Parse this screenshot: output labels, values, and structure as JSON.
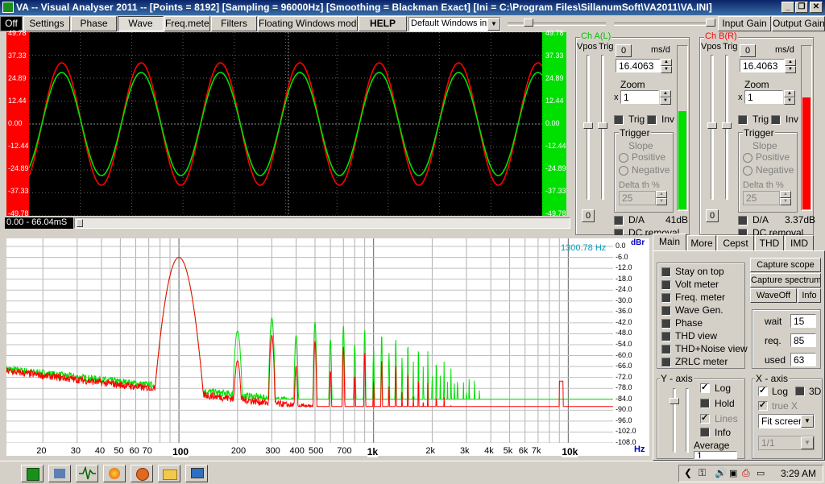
{
  "window": {
    "title": "VA -- Visual Analyser 2011 --  [Points = 8192]  [Sampling = 96000Hz]  [Smoothing = Blackman Exact]  [Ini = C:\\Program Files\\SillanumSoft\\VA2011\\VA.INI]"
  },
  "toolbar": {
    "off": "Off",
    "settings": "Settings",
    "phase": "Phase",
    "wave": "Wave",
    "freqmeter": "Freq.meter",
    "filters": "Filters",
    "floating": "Floating Windows mode",
    "help": "HELP",
    "layout_select": "Default Windows inp",
    "input_gain": "Input Gain",
    "output_gain": "Output Gain"
  },
  "scope": {
    "left_ticks": [
      "49.78",
      "37.33",
      "24.89",
      "12.44",
      "0.00",
      "-12.44",
      "-24.89",
      "-37.33",
      "-49.78"
    ],
    "right_ticks": [
      "49.78",
      "37.33",
      "24.89",
      "12.44",
      "0.00",
      "-12.44",
      "-24.89",
      "-37.33",
      "-49.78"
    ],
    "time_range": "0.00 - 66.04mS"
  },
  "channel_left": {
    "title": "Ch A(L)",
    "vpos": "Vpos",
    "trig": "Trig",
    "ms_value": "0",
    "ms_unit": "ms/d",
    "ms_field": "16.4063",
    "zoom_label": "Zoom",
    "zoom_x": "x",
    "zoom_value": "1",
    "trig_chk": "Trig",
    "inv_chk": "Inv",
    "trigger_group": "Trigger",
    "slope": "Slope",
    "positive": "Positive",
    "negative": "Negative",
    "delta": "Delta th %",
    "delta_value": "25",
    "vpos_value": "0",
    "da": "D/A",
    "dcremoval": "DC removal",
    "level": "41dB",
    "level_fraction": 0.6
  },
  "channel_right": {
    "title": "Ch B(R)",
    "vpos": "Vpos",
    "trig": "Trig",
    "ms_value": "0",
    "ms_unit": "ms/d",
    "ms_field": "16.4063",
    "zoom_label": "Zoom",
    "zoom_x": "x",
    "zoom_value": "1",
    "trig_chk": "Trig",
    "inv_chk": "Inv",
    "trigger_group": "Trigger",
    "slope": "Slope",
    "positive": "Positive",
    "negative": "Negative",
    "delta": "Delta th %",
    "delta_value": "25",
    "vpos_value": "0",
    "da": "D/A",
    "dcremoval": "DC removal",
    "level": "3.37dB",
    "level_fraction": 0.68
  },
  "spectrum": {
    "cursor_freq": "1300.78 Hz",
    "db_unit": "dBr",
    "hz_unit": "Hz",
    "db_ticks": [
      "0.0",
      "-6.0",
      "-12.0",
      "-18.0",
      "-24.0",
      "-30.0",
      "-36.0",
      "-42.0",
      "-48.0",
      "-54.0",
      "-60.0",
      "-66.0",
      "-72.0",
      "-78.0",
      "-84.0",
      "-90.0",
      "-96.0",
      "-102.0",
      "-108.0"
    ],
    "freq_ticks": [
      {
        "label": "20",
        "f": 20,
        "bold": false
      },
      {
        "label": "30",
        "f": 30,
        "bold": false
      },
      {
        "label": "40",
        "f": 40,
        "bold": false
      },
      {
        "label": "50",
        "f": 50,
        "bold": false
      },
      {
        "label": "60",
        "f": 60,
        "bold": false
      },
      {
        "label": "70",
        "f": 70,
        "bold": false
      },
      {
        "label": "100",
        "f": 100,
        "bold": true
      },
      {
        "label": "200",
        "f": 200,
        "bold": false
      },
      {
        "label": "300",
        "f": 300,
        "bold": false
      },
      {
        "label": "400",
        "f": 400,
        "bold": false
      },
      {
        "label": "500",
        "f": 500,
        "bold": false
      },
      {
        "label": "700",
        "f": 700,
        "bold": false
      },
      {
        "label": "1k",
        "f": 1000,
        "bold": true
      },
      {
        "label": "2k",
        "f": 2000,
        "bold": false
      },
      {
        "label": "3k",
        "f": 3000,
        "bold": false
      },
      {
        "label": "4k",
        "f": 4000,
        "bold": false
      },
      {
        "label": "5k",
        "f": 5000,
        "bold": false
      },
      {
        "label": "6k",
        "f": 6000,
        "bold": false
      },
      {
        "label": "7k",
        "f": 7000,
        "bold": false
      },
      {
        "label": "10k",
        "f": 10000,
        "bold": true
      }
    ]
  },
  "tabs": {
    "main": "Main",
    "more": "More",
    "cepst": "Cepst",
    "thd": "THD",
    "imd": "IMD"
  },
  "main_panel": {
    "checks": [
      "Stay on top",
      "Volt meter",
      "Freq. meter",
      "Wave Gen.",
      "Phase",
      "THD view",
      "THD+Noise view",
      "ZRLC meter"
    ],
    "capture_scope": "Capture scope",
    "capture_spectrum": "Capture spectrum",
    "waveoff": "WaveOff",
    "info": "Info",
    "wait_label": "wait",
    "wait_value": "15",
    "req_label": "req.",
    "req_value": "85",
    "used_label": "used",
    "used_value": "63",
    "yaxis_group": "Y - axis",
    "xaxis_group": "X - axis",
    "y_log": "Log",
    "y_hold": "Hold",
    "y_lines": "Lines",
    "y_info": "Info",
    "average": "Average",
    "average_value": "1",
    "x_log": "Log",
    "x_3d": "3D",
    "x_truex": "true X",
    "fit_screen": "Fit screen",
    "ratio": "1/1"
  },
  "taskbar": {
    "time": "3:29 AM"
  },
  "colors": {
    "ch_left": "#ff0000",
    "ch_right": "#00e000",
    "scope_bg": "#000000",
    "cursor_text": "#00a0c0",
    "axis_blue": "#0000c0"
  }
}
